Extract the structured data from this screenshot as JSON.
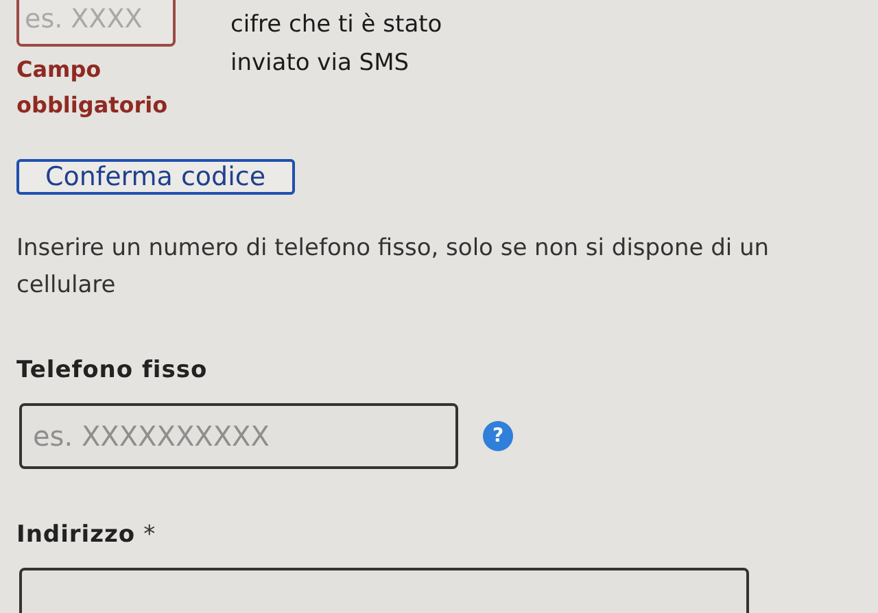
{
  "code_field": {
    "placeholder": "es. XXXX",
    "error": "Campo obbligatorio",
    "hint": "cifre che ti è stato inviato via SMS"
  },
  "confirm_button": {
    "label": "Conferma codice"
  },
  "landline_note": "Inserire un numero di telefono fisso, solo se non si dispone di un cellulare",
  "landline_field": {
    "label": "Telefono fisso",
    "placeholder": "es. XXXXXXXXXX",
    "help": "?"
  },
  "address_field": {
    "label": "Indirizzo",
    "required": true,
    "required_mark": "*"
  }
}
